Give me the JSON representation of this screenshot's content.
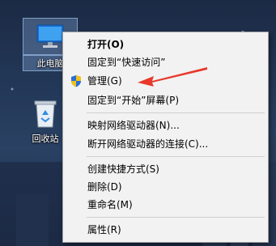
{
  "desktop": {
    "icons": [
      {
        "label": "此电脑"
      },
      {
        "label": "回收站"
      }
    ]
  },
  "context_menu": {
    "items": [
      {
        "label": "打开(O)",
        "bold": true
      },
      {
        "label": "固定到“快速访问”"
      },
      {
        "label": "管理(G)",
        "icon": "uac-shield-icon"
      },
      {
        "label": "固定到“开始”屏幕(P)"
      },
      {
        "label": "映射网络驱动器(N)..."
      },
      {
        "label": "断开网络驱动器的连接(C)..."
      },
      {
        "label": "创建快捷方式(S)"
      },
      {
        "label": "删除(D)"
      },
      {
        "label": "重命名(M)"
      },
      {
        "label": "属性(R)"
      }
    ]
  },
  "annotation": {
    "arrow_color": "#e8392b"
  }
}
